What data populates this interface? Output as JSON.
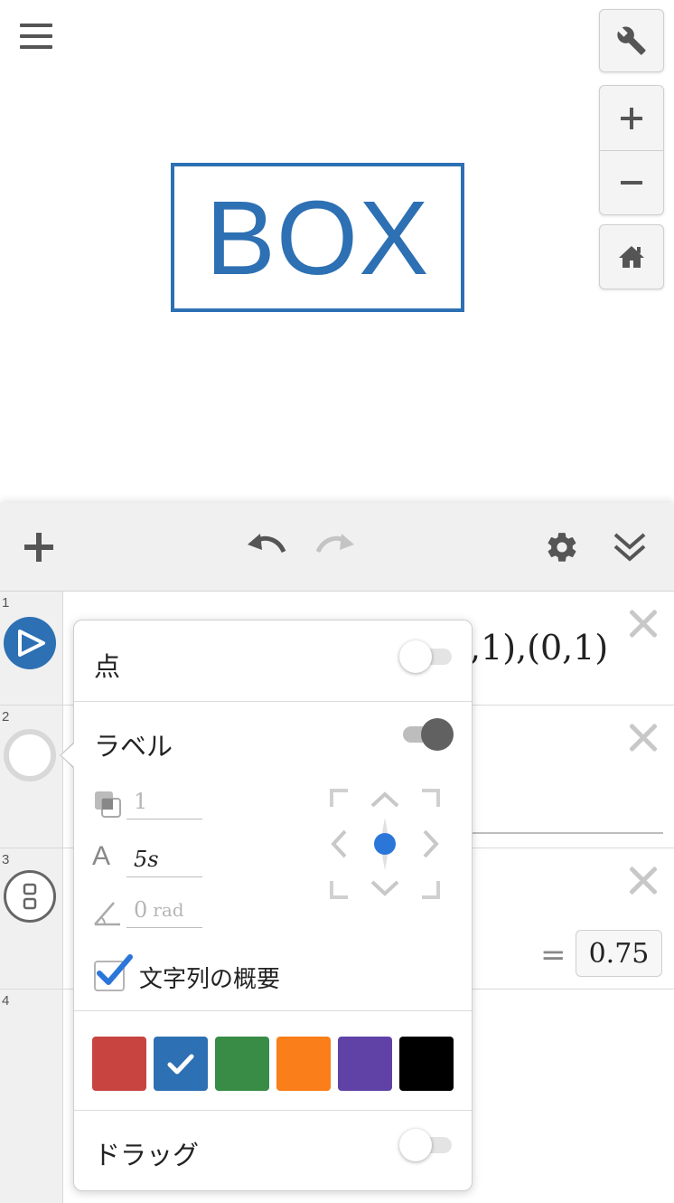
{
  "canvas": {
    "box_text": "BOX",
    "box_color": "#2d70b3"
  },
  "toolbar": {
    "add_icon": "plus-icon",
    "undo_icon": "undo-icon",
    "redo_icon": "redo-icon",
    "settings_icon": "gear-icon",
    "collapse_icon": "double-chevron-down-icon"
  },
  "expressions": [
    {
      "number": "1",
      "visible_text": ",1),(0,1)",
      "icon": "polygon-play-icon"
    },
    {
      "number": "2",
      "icon": "empty-circle-icon"
    },
    {
      "number": "3",
      "icon": "slider-icon",
      "value": "0.75",
      "equals": "="
    },
    {
      "number": "4"
    }
  ],
  "popover": {
    "points_label": "点",
    "points_on": false,
    "label_label": "ラベル",
    "label_on": true,
    "opacity_value": "1",
    "size_value": "5s",
    "size_icon_text": "A",
    "angle_value": "0",
    "angle_unit": "rad",
    "text_summary_label": "文字列の概要",
    "text_summary_checked": true,
    "drag_label": "ドラッグ",
    "drag_on": false,
    "colors": [
      "#c74440",
      "#2d70b3",
      "#388c46",
      "#fa7e19",
      "#6042a6",
      "#000000"
    ],
    "selected_color": "#2d70b3"
  }
}
